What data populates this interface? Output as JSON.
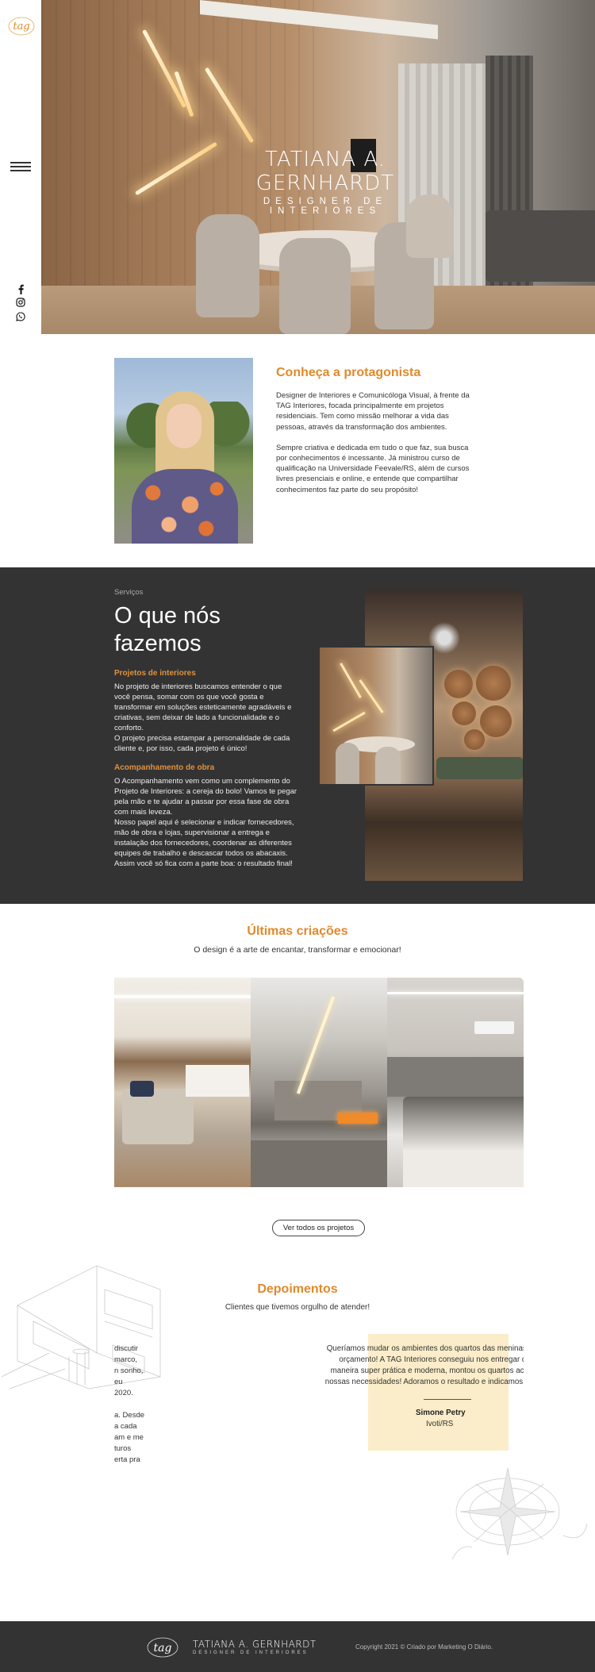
{
  "brand": {
    "logo_text": "tag",
    "name": "TATIANA A. GERNHARDT",
    "role": "DESIGNER DE INTERIORES"
  },
  "rail": {
    "social_icons": [
      "facebook-icon",
      "instagram-icon",
      "whatsapp-icon"
    ]
  },
  "hero": {
    "title": "TATIANA A. GERNHARDT",
    "subtitle": "DESIGNER DE INTERIORES"
  },
  "about": {
    "heading": "Conheça a protagonista",
    "paragraph1": "Designer de Interiores e Comunicóloga Visual, à frente da TAG Interiores, focada principalmente em projetos residenciais. Tem como missão melhorar a vida das pessoas, através da transformação dos ambientes.",
    "paragraph2": "Sempre criativa e dedicada em tudo o que faz, sua busca por conhecimentos é incessante. Já ministrou curso de qualificação na Universidade Feevale/RS, além de cursos livres presenciais e online, e entende que compartilhar conhecimentos faz parte do seu propósito!"
  },
  "services": {
    "eyebrow": "Serviços",
    "title": "O que nós fazemos",
    "items": [
      {
        "heading": "Projetos de interiores",
        "text": "No projeto de interiores buscamos entender o que você pensa, somar com os que você gosta e transformar em soluções esteticamente agradáveis e criativas, sem deixar de lado a funcionalidade e o conforto.\nO projeto precisa estampar a personalidade de cada cliente e, por isso, cada projeto é único!"
      },
      {
        "heading": "Acompanhamento de obra",
        "text": "O Acompanhamento vem como um complemento do Projeto de Interiores: a cereja do bolo! Vamos te pegar pela mão e te ajudar a passar por essa fase de obra com mais leveza.\nNosso papel aqui é selecionar e indicar fornecedores, mão de obra e lojas, supervisionar a entrega e instalação dos fornecedores, coordenar as diferentes equipes de trabalho e descascar todos os abacaxis. Assim você só fica com a parte boa: o resultado final!"
      }
    ]
  },
  "portfolio": {
    "title": "Últimas criações",
    "subtitle": "O design é a arte de encantar, transformar e emocionar!",
    "button": "Ver todos os projetos"
  },
  "testimonials": {
    "title": "Depoimentos",
    "subtitle": "Clientes que tivemos orgulho de atender!",
    "prev_fragment_lines": [
      "discutir",
      "marco,",
      "n sonho,",
      "eu",
      " 2020.",
      "",
      "a. Desde",
      "a cada",
      "am e me",
      "turos",
      "erta pra"
    ],
    "quote": "Queríamos mudar os ambientes dos quartos das meninas do nosso orçamento! A TAG Interiores conseguiu nos entregar de uma maneira super prática e moderna, montou os quartos acordo com nossas necessidades! Adoramos o resultado e indicamos o trabalho!",
    "name": "Simone Petry",
    "city": "Ivoti/RS"
  },
  "footer": {
    "copyright": "Copyright 2021 © Criado por Marketing O Diário."
  },
  "colors": {
    "accent": "#e08a2b",
    "dark_band": "#333333",
    "quote_highlight": "#fbedc9"
  }
}
